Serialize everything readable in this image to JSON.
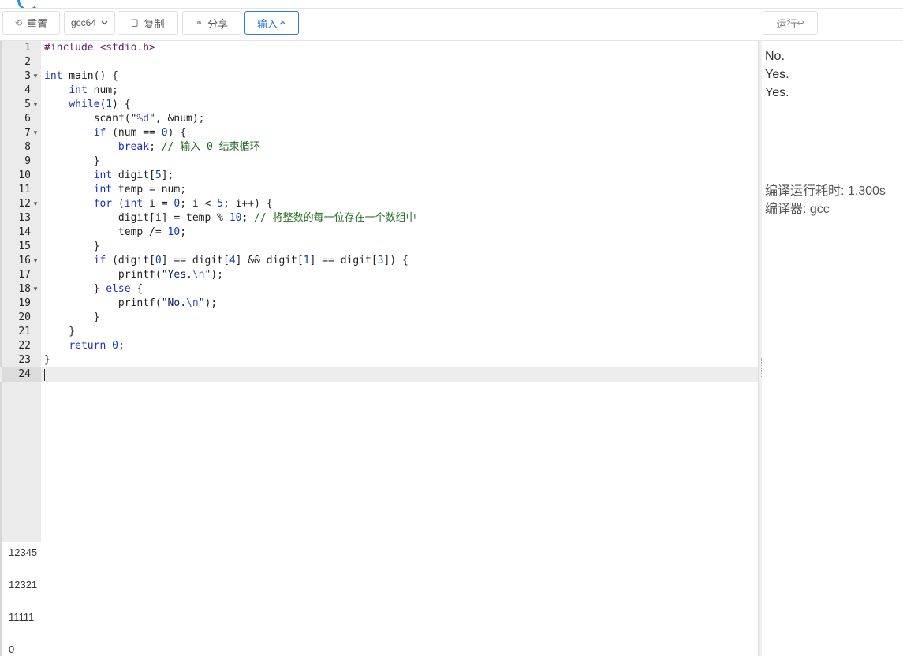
{
  "toolbar": {
    "reset_label": "重置",
    "compiler_value": "gcc64",
    "copy_label": "复制",
    "share_label": "分享",
    "input_label": "输入",
    "run_label": "运行"
  },
  "icons": {
    "reset": "undo-icon",
    "compiler": "chevron-down-icon",
    "copy": "copy-icon",
    "share": "link-icon",
    "input": "chevron-up-icon",
    "run": "enter-icon"
  },
  "editor": {
    "active_line": 24,
    "lines": [
      "#include <stdio.h>",
      "",
      "int main() {",
      "    int num;",
      "    while(1) {",
      "        scanf(\"%d\", &num);",
      "        if (num == 0) {",
      "            break; // 输入 0 结束循环",
      "        }",
      "        int digit[5];",
      "        int temp = num;",
      "        for (int i = 0; i < 5; i++) {",
      "            digit[i] = temp % 10; // 将整数的每一位存在一个数组中",
      "            temp /= 10;",
      "        }",
      "        if (digit[0] == digit[4] && digit[1] == digit[3]) {",
      "            printf(\"Yes.\\n\");",
      "        } else {",
      "            printf(\"No.\\n\");",
      "        }",
      "    }",
      "    return 0;",
      "}",
      ""
    ],
    "fold_lines": [
      3,
      5,
      7,
      12,
      16,
      18
    ]
  },
  "input": {
    "lines": [
      "12345",
      "12321",
      "11111",
      "0"
    ]
  },
  "output": {
    "lines": [
      "No.",
      "Yes.",
      "Yes."
    ],
    "time_label": "编译运行耗时: 1.300s",
    "compiler_label": "编译器: gcc"
  },
  "colors": {
    "accent": "#2e7bd0",
    "keyword": "#1c2fc8",
    "comment": "#216b21",
    "gutter": "#ebebeb"
  }
}
